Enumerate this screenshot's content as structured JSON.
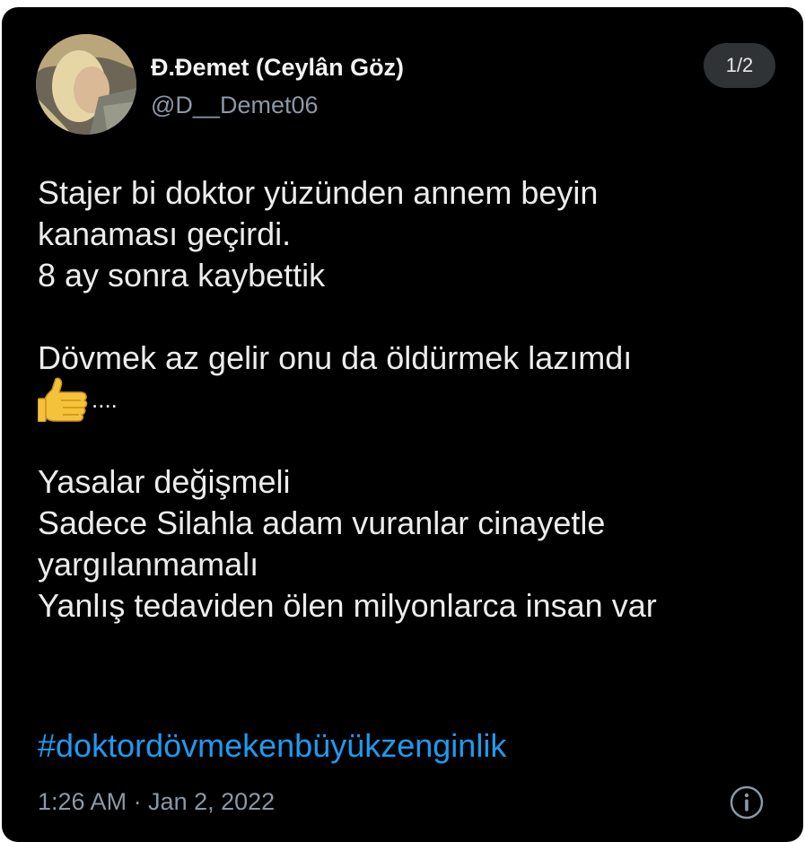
{
  "tweet": {
    "display_name": "Đ.Đemet (Ceylân Göz)",
    "handle": "@D__Demet06",
    "thread_position": "1/2",
    "lines": {
      "l1": "Stajer bi doktor yüzünden annem beyin",
      "l2": "kanaması geçirdi.",
      "l3": "8 ay sonra kaybettik",
      "l4": "Dövmek az gelir  onu da öldürmek lazımdı",
      "l5": "....",
      "l6": "Yasalar değişmeli",
      "l7": "Sadece Silahla adam vuranlar cinayetle",
      "l8": "yargılanmamalı",
      "l9": "Yanlış tedaviden ölen milyonlarca insan var"
    },
    "hashtag": "#doktordövmekenbüyükzenginlik",
    "timestamp": "1:26 AM · Jan 2, 2022"
  },
  "icons": {
    "avatar": "profile-photo",
    "emoji": "thumbs-up-emoji",
    "info": "info-circle-icon"
  },
  "colors": {
    "background": "#000000",
    "link": "#1d9bf0",
    "secondary_text": "#8b98a5",
    "badge_bg": "#2f3336"
  }
}
